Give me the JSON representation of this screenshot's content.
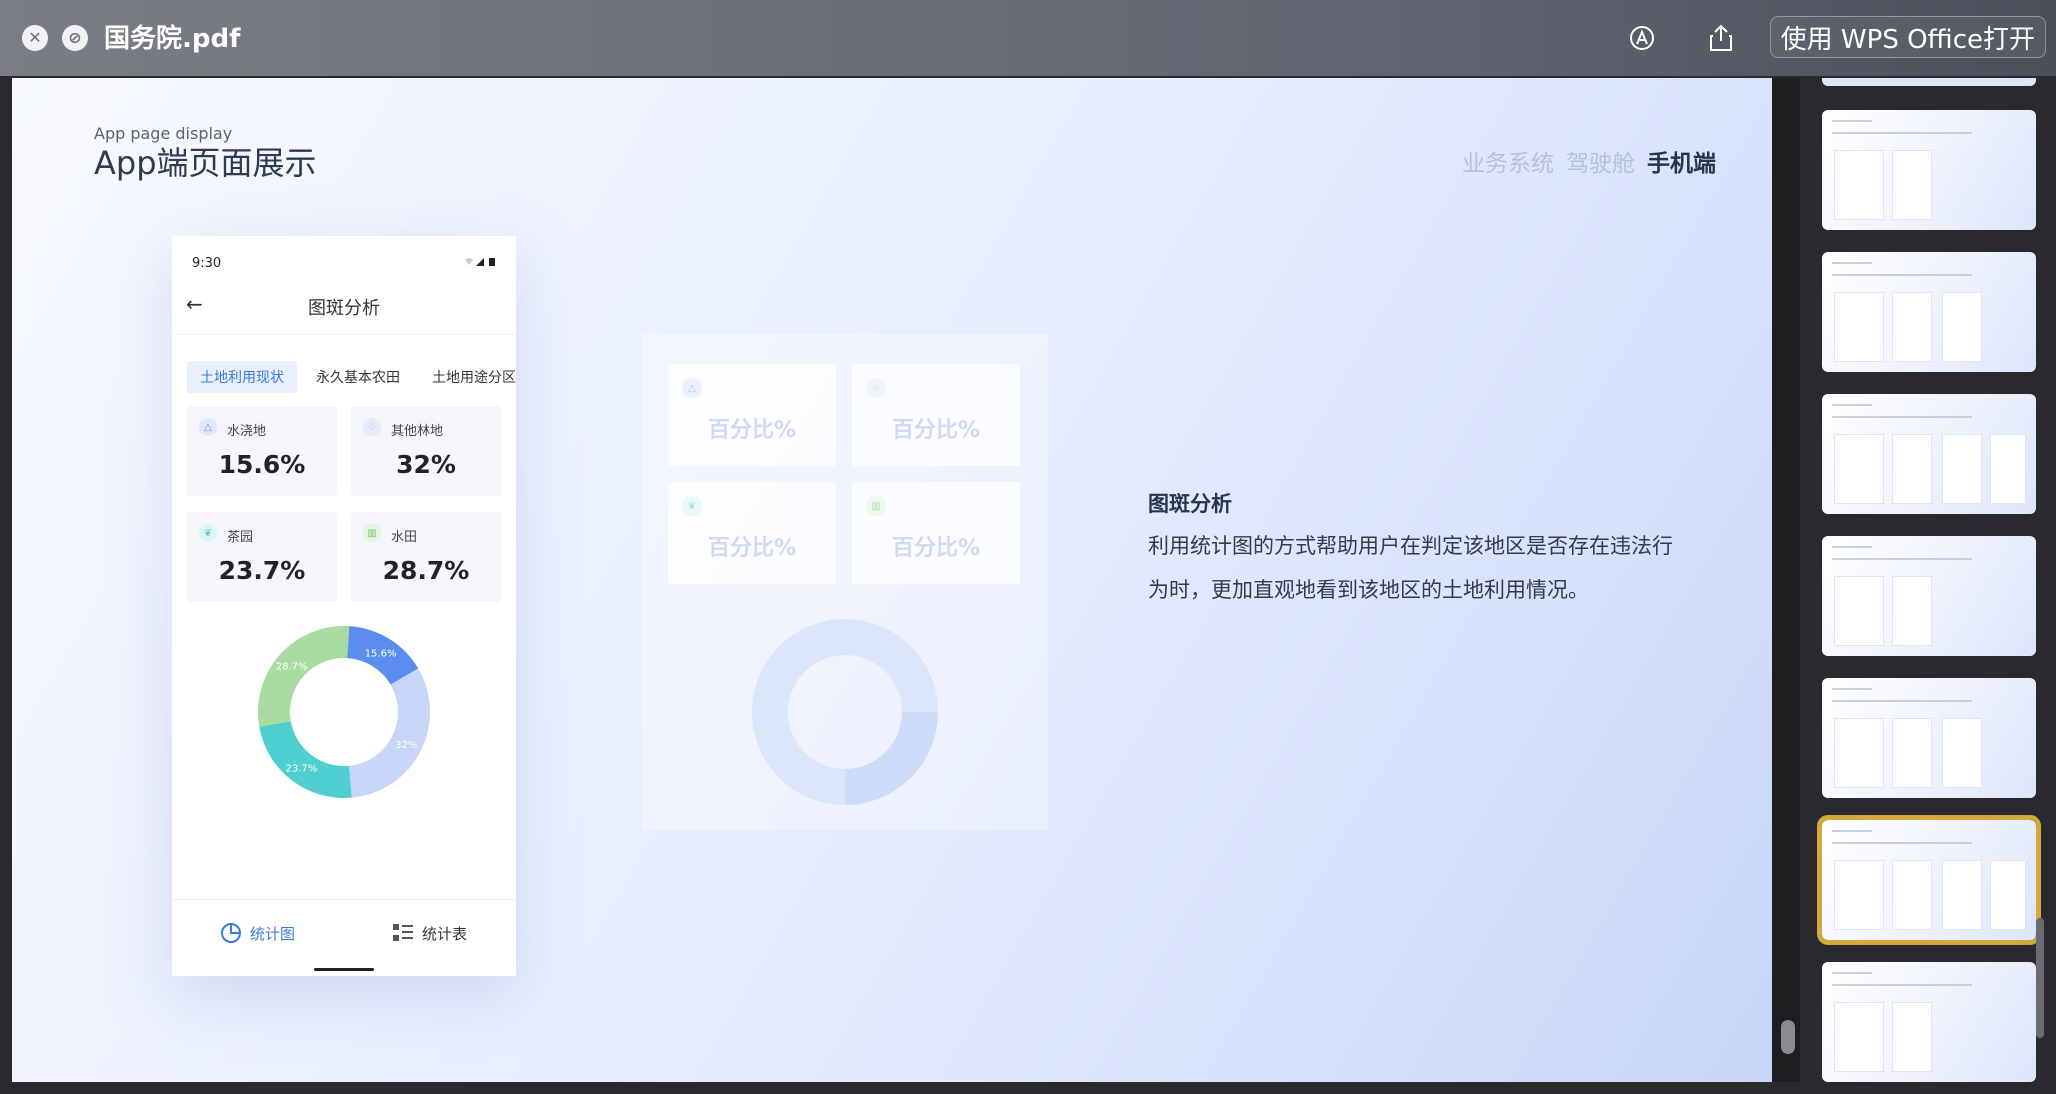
{
  "window": {
    "title": "国务院.pdf",
    "open_with_label": "使用 WPS Office打开",
    "icons": [
      "close-icon",
      "disable-icon",
      "annotate-icon",
      "share-icon"
    ]
  },
  "slide": {
    "subtitle_en": "App page display",
    "title": "App端页面展示",
    "nav": [
      "业务系统",
      "驾驶舱",
      "手机端"
    ],
    "nav_active": "手机端"
  },
  "phone": {
    "time": "9:30",
    "status_icons": "wifi signal battery",
    "header_title": "图斑分析",
    "tabs": [
      "土地利用现状",
      "永久基本农田",
      "土地用途分区"
    ],
    "active_tab": "土地利用现状",
    "stats": [
      {
        "label": "水浇地",
        "value": "15.6%",
        "icon": "irrigation-icon",
        "color": "#5b8def"
      },
      {
        "label": "其他林地",
        "value": "32%",
        "icon": "forest-icon",
        "color": "#a9c1f0"
      },
      {
        "label": "茶园",
        "value": "23.7%",
        "icon": "leaf-icon",
        "color": "#5ccfd6"
      },
      {
        "label": "水田",
        "value": "28.7%",
        "icon": "paddy-icon",
        "color": "#8ed68a"
      }
    ],
    "footer": {
      "chart_label": "统计图",
      "table_label": "统计表"
    }
  },
  "chart_data": {
    "type": "pie",
    "categories": [
      "水浇地",
      "其他林地",
      "茶园",
      "水田"
    ],
    "values": [
      15.6,
      32,
      23.7,
      28.7
    ],
    "labels": [
      "15.6%",
      "32%",
      "23.7%",
      "28.7%"
    ],
    "colors": [
      "#5b8def",
      "#c7d6f6",
      "#4fcfcf",
      "#a8dba0"
    ],
    "donut": true
  },
  "illustration": {
    "card_text": "百分比%",
    "card_count": 4
  },
  "description": {
    "title": "图斑分析",
    "lines": [
      "利用统计图的方式帮助用户在判定该地区是否存在违法行",
      "为时，更加直观地看到该地区的土地利用情况。"
    ]
  },
  "sidebar": {
    "thumbnail_count": 7,
    "active_index": 5
  }
}
